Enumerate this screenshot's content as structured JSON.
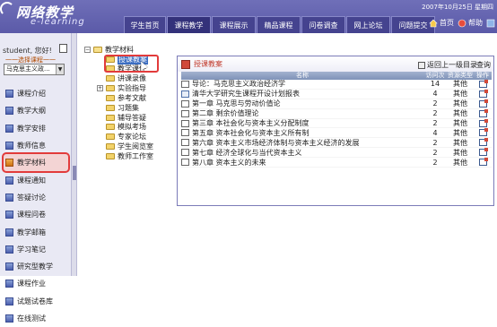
{
  "header": {
    "logo_main": "网络教学",
    "logo_sub": "e-learning",
    "date": "2007年10月25日 星期四",
    "nav_tabs": [
      {
        "label": "学生首页",
        "active": false
      },
      {
        "label": "课程教学",
        "active": true
      },
      {
        "label": "课程展示",
        "active": false
      },
      {
        "label": "精品课程",
        "active": false
      },
      {
        "label": "问卷调查",
        "active": false
      },
      {
        "label": "网上论坛",
        "active": false
      },
      {
        "label": "问题提交",
        "active": false
      }
    ],
    "util": [
      {
        "label": "首页",
        "icon": "home-icon"
      },
      {
        "label": "帮助",
        "icon": "help-icon"
      },
      {
        "label": "",
        "icon": "exit-icon"
      }
    ]
  },
  "sidebar": {
    "student_label": "student, 您好!",
    "course_hint": "一一选择课程一一",
    "course_value": "马克思主义政...",
    "items": [
      {
        "label": "课程介绍",
        "active": false
      },
      {
        "label": "教学大纲",
        "active": false
      },
      {
        "label": "教学安排",
        "active": false
      },
      {
        "label": "教师信息",
        "active": false
      },
      {
        "label": "教学材料",
        "active": true
      },
      {
        "label": "课程通知",
        "active": false
      },
      {
        "label": "答疑讨论",
        "active": false
      },
      {
        "label": "课程问卷",
        "active": false
      },
      {
        "label": "教学邮箱",
        "active": false
      },
      {
        "label": "学习笔记",
        "active": false
      },
      {
        "label": "研究型教学",
        "active": false
      },
      {
        "label": "课程作业",
        "active": false
      },
      {
        "label": "试题试卷库",
        "active": false
      },
      {
        "label": "在线测试",
        "active": false
      }
    ]
  },
  "tree": {
    "root": "教学材料",
    "items": [
      {
        "label": "授课教案",
        "selected": true,
        "expand": false
      },
      {
        "label": "教学课件",
        "selected": false,
        "expand": false
      },
      {
        "label": "讲课录像",
        "selected": false,
        "expand": false
      },
      {
        "label": "实验指导",
        "selected": false,
        "expand": true
      },
      {
        "label": "参考文献",
        "selected": false,
        "expand": false
      },
      {
        "label": "习题集",
        "selected": false,
        "expand": false
      },
      {
        "label": "辅导答疑",
        "selected": false,
        "expand": false
      },
      {
        "label": "模拟考场",
        "selected": false,
        "expand": false
      },
      {
        "label": "专家论坛",
        "selected": false,
        "expand": false
      },
      {
        "label": "学生阅览室",
        "selected": false,
        "expand": false
      },
      {
        "label": "教师工作室",
        "selected": false,
        "expand": false
      }
    ]
  },
  "panel": {
    "title": "授课教案",
    "up_link": "返回上一级目录",
    "search": "查询",
    "columns": {
      "name": "名称",
      "count": "访问次数",
      "type": "资源类型",
      "action": "操作"
    },
    "rows": [
      {
        "name": "导论：马克思主义政治经济学",
        "count": "14",
        "type": "其他",
        "icon": "file-icon"
      },
      {
        "name": "清华大学研究生课程开设计划报表",
        "count": "4",
        "type": "其他",
        "icon": "doc-icon"
      },
      {
        "name": "第一章  马克思与劳动价值论",
        "count": "2",
        "type": "其他",
        "icon": "file-icon"
      },
      {
        "name": "第二章  剩余价值理论",
        "count": "2",
        "type": "其他",
        "icon": "file-icon"
      },
      {
        "name": "第三章  本社会化与资本主义分配制度",
        "count": "2",
        "type": "其他",
        "icon": "file-icon"
      },
      {
        "name": "第五章  资本社会化与资本主义所有制",
        "count": "4",
        "type": "其他",
        "icon": "file-icon"
      },
      {
        "name": "第六章  资本主义市场经济体制与资本主义经济的发展",
        "count": "2",
        "type": "其他",
        "icon": "file-icon"
      },
      {
        "name": "第七章  经济全球化与当代资本主义",
        "count": "2",
        "type": "其他",
        "icon": "file-icon"
      },
      {
        "name": "第八章  资本主义的未来",
        "count": "2",
        "type": "其他",
        "icon": "file-icon"
      }
    ]
  }
}
